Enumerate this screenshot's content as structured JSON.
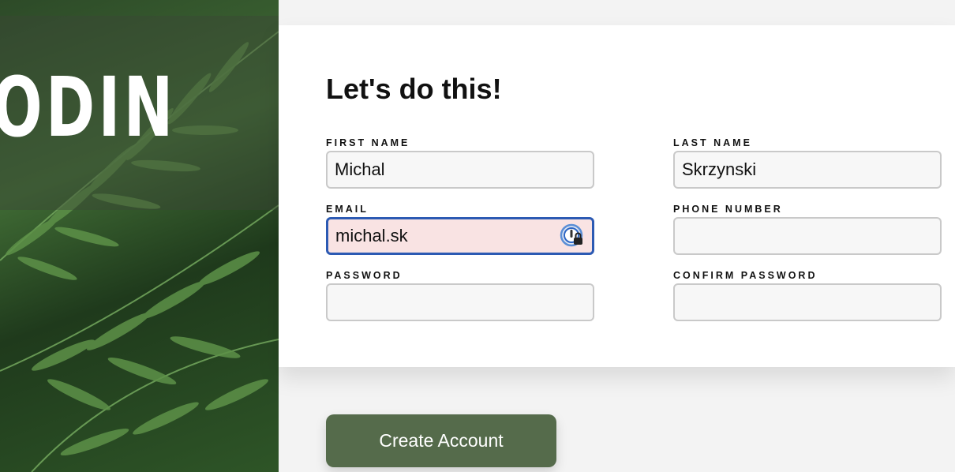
{
  "brand": {
    "logo_text": "ODIN"
  },
  "form": {
    "heading": "Let's do this!",
    "fields": {
      "first_name": {
        "label": "FIRST NAME",
        "value": "Michal"
      },
      "last_name": {
        "label": "LAST NAME",
        "value": "Skrzynski"
      },
      "email": {
        "label": "EMAIL",
        "value": "michal.sk",
        "state": "invalid",
        "icon": "password-manager-icon"
      },
      "phone": {
        "label": "PHONE NUMBER",
        "value": ""
      },
      "password": {
        "label": "PASSWORD",
        "value": ""
      },
      "confirm_password": {
        "label": "CONFIRM PASSWORD",
        "value": ""
      }
    },
    "submit_label": "Create Account"
  },
  "colors": {
    "button": "#556b4b",
    "invalid_bg": "#f9e3e3",
    "focus_border": "#2c5ab3",
    "input_bg": "#f7f7f7"
  }
}
